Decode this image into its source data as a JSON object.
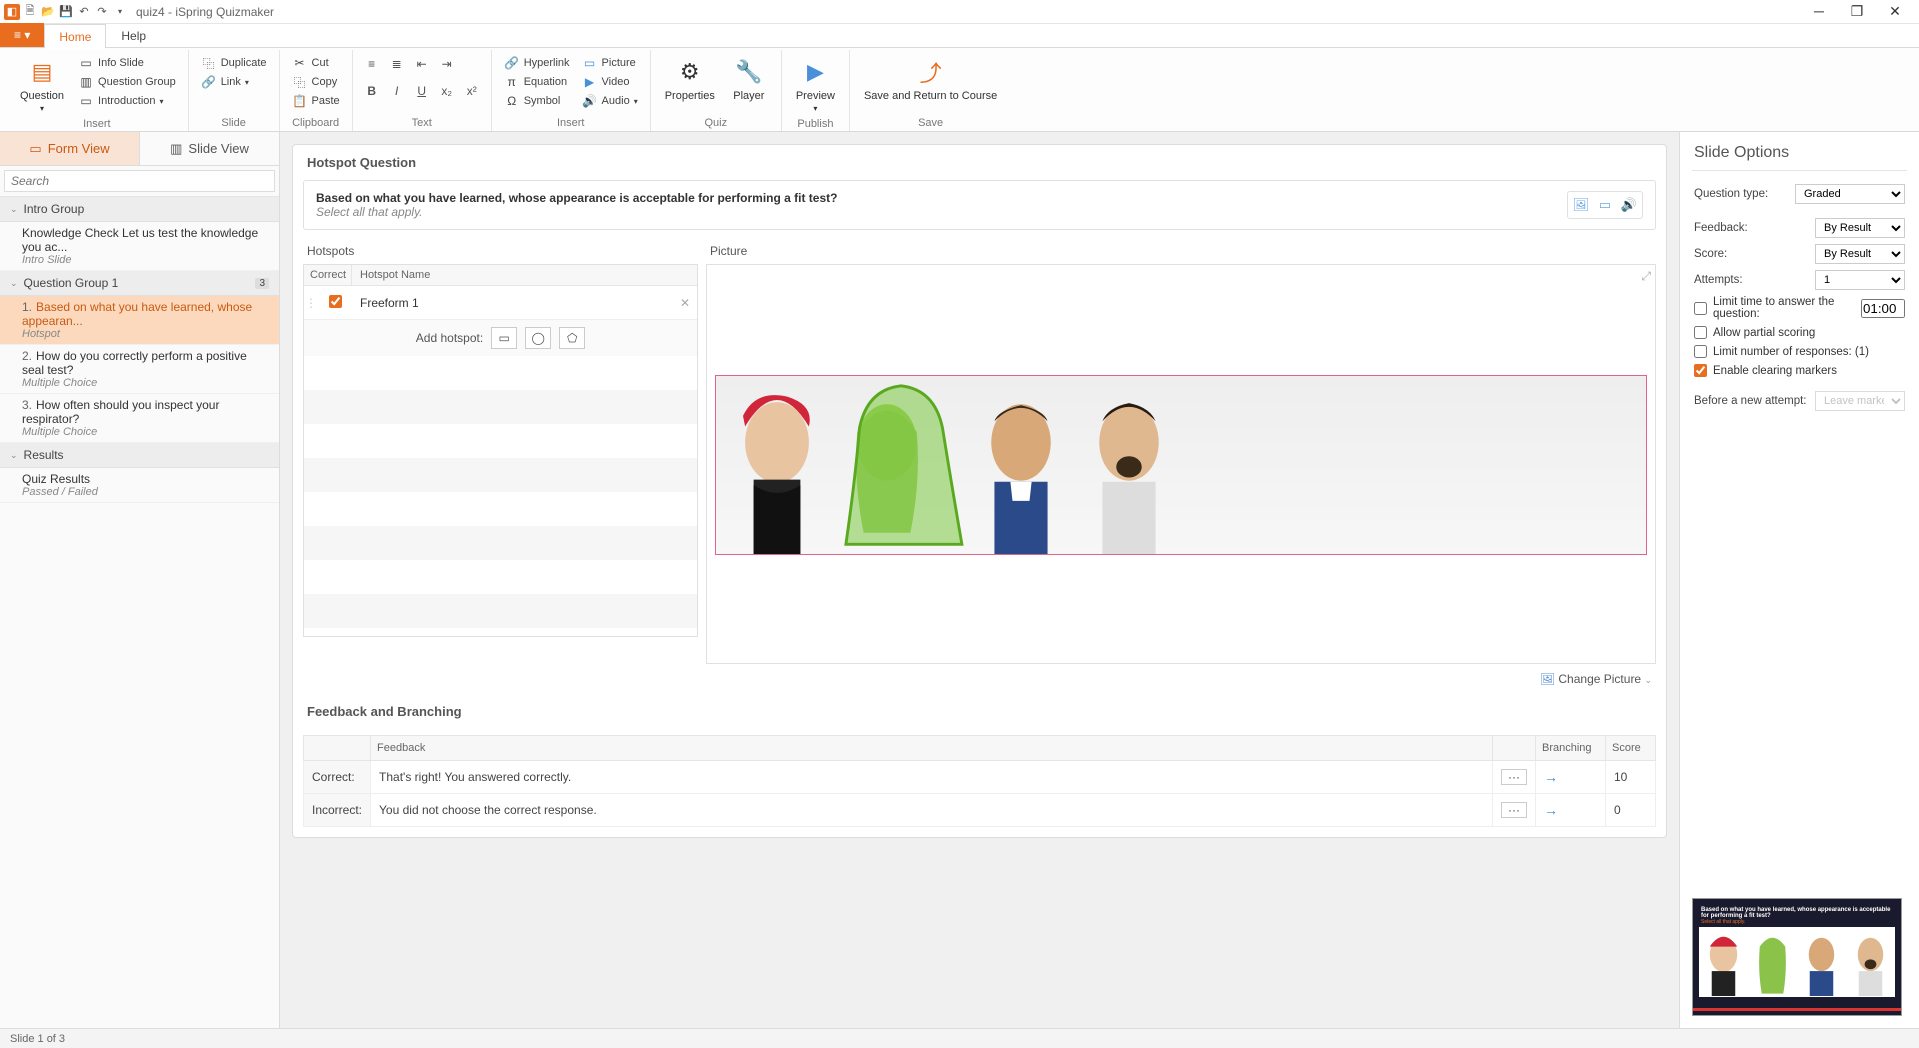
{
  "app": {
    "title": "quiz4 - iSpring Quizmaker"
  },
  "tabs": {
    "file": "≡ ▾",
    "home": "Home",
    "help": "Help"
  },
  "ribbon": {
    "question_label": "Question",
    "info_slide": "Info Slide",
    "question_group": "Question Group",
    "introduction": "Introduction",
    "insert": "Insert",
    "duplicate": "Duplicate",
    "link": "Link",
    "slide": "Slide",
    "cut": "Cut",
    "copy": "Copy",
    "paste": "Paste",
    "clipboard": "Clipboard",
    "text": "Text",
    "hyperlink": "Hyperlink",
    "equation": "Equation",
    "symbol": "Symbol",
    "picture": "Picture",
    "video": "Video",
    "audio": "Audio",
    "properties": "Properties",
    "player": "Player",
    "quiz": "Quiz",
    "preview": "Preview",
    "publish": "Publish",
    "save_return": "Save and Return to Course",
    "save": "Save"
  },
  "views": {
    "form": "Form View",
    "slide": "Slide View"
  },
  "search": {
    "placeholder": "Search"
  },
  "nav": {
    "intro_group": "Intro Group",
    "intro_item": "Knowledge Check Let us test the knowledge you ac...",
    "intro_sub": "Intro Slide",
    "qgroup": "Question Group 1",
    "qcount": "3",
    "q1_num": "1.",
    "q1": "Based on what you have learned, whose appearan...",
    "q1_sub": "Hotspot",
    "q2_num": "2.",
    "q2": "How do you correctly perform a positive seal test?",
    "q2_sub": "Multiple Choice",
    "q3_num": "3.",
    "q3": "How often should you inspect your respirator?",
    "q3_sub": "Multiple Choice",
    "results": "Results",
    "results_item": "Quiz Results",
    "results_sub": "Passed / Failed"
  },
  "editor": {
    "section": "Hotspot Question",
    "question": "Based on what you have learned, whose appearance is acceptable for performing a fit test?",
    "hint": "Select all that apply.",
    "hotspots_title": "Hotspots",
    "picture_title": "Picture",
    "col_correct": "Correct",
    "col_name": "Hotspot Name",
    "hs1": "Freeform 1",
    "add_hotspot": "Add hotspot:",
    "change_picture": "Change Picture",
    "feedback_title": "Feedback and Branching",
    "fb_feedback": "Feedback",
    "fb_branching": "Branching",
    "fb_score": "Score",
    "correct_lbl": "Correct:",
    "correct_txt": "That's right! You answered correctly.",
    "correct_score": "10",
    "incorrect_lbl": "Incorrect:",
    "incorrect_txt": "You did not choose the correct response.",
    "incorrect_score": "0"
  },
  "options": {
    "title": "Slide Options",
    "qtype_lbl": "Question type:",
    "qtype": "Graded",
    "feedback_lbl": "Feedback:",
    "feedback": "By Result",
    "score_lbl": "Score:",
    "score": "By Result",
    "attempts_lbl": "Attempts:",
    "attempts": "1",
    "limit_time": "Limit time to answer the question:",
    "limit_time_val": "01:00",
    "partial": "Allow partial scoring",
    "limit_resp": "Limit number of responses: (1)",
    "clear_markers": "Enable clearing markers",
    "before_lbl": "Before a new attempt:",
    "before_val": "Leave markers..."
  },
  "thumb": {
    "q": "Based on what you have learned, whose appearance is acceptable for performing a fit test?",
    "h": "Select all that apply."
  },
  "status": {
    "text": "Slide 1 of 3"
  }
}
